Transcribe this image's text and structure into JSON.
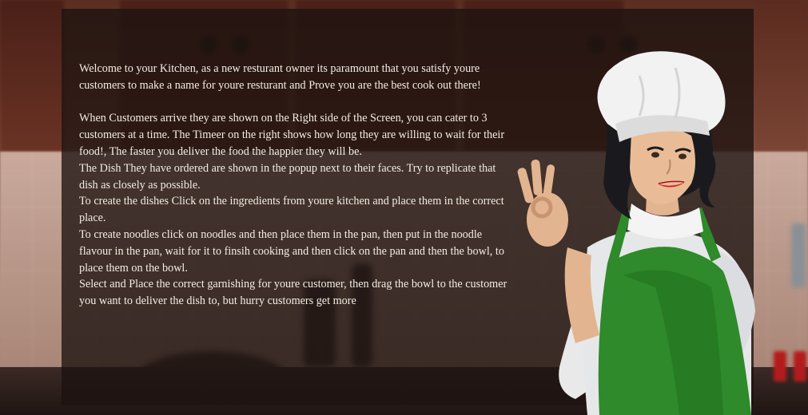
{
  "instructions": [
    "Welcome to your Kitchen,  as a new resturant owner its paramount that you satisfy youre customers to make a name for youre resturant and Prove you are the best cook out there!",
    "When Customers arrive they are shown on the Right side of the Screen,  you can cater to 3 customers at a time.  The Timeer on the right shows how long they are willing to wait for their food!, The faster you deliver the food the happier they will be.",
    "The Dish They have ordered are shown in the popup next to their faces. Try to replicate that dish as closely as possible.",
    "To create the dishes Click on the ingredients from youre kitchen and place them in the correct place.",
    "To create noodles click on noodles and then place them in the pan, then put in the noodle flavour in the pan, wait for it to finsih cooking and then click on the pan and then the bowl, to place them on the bowl.",
    "Select and Place the correct garnishing for youre customer, then drag the bowl to the customer you want to deliver the dish to, but hurry customers get more"
  ],
  "colors": {
    "overlay": "#1c1210",
    "text": "#f3ede4",
    "apron": "#2e8a2a",
    "hat": "#f2f2f2"
  },
  "icons": [
    "chef-character"
  ]
}
